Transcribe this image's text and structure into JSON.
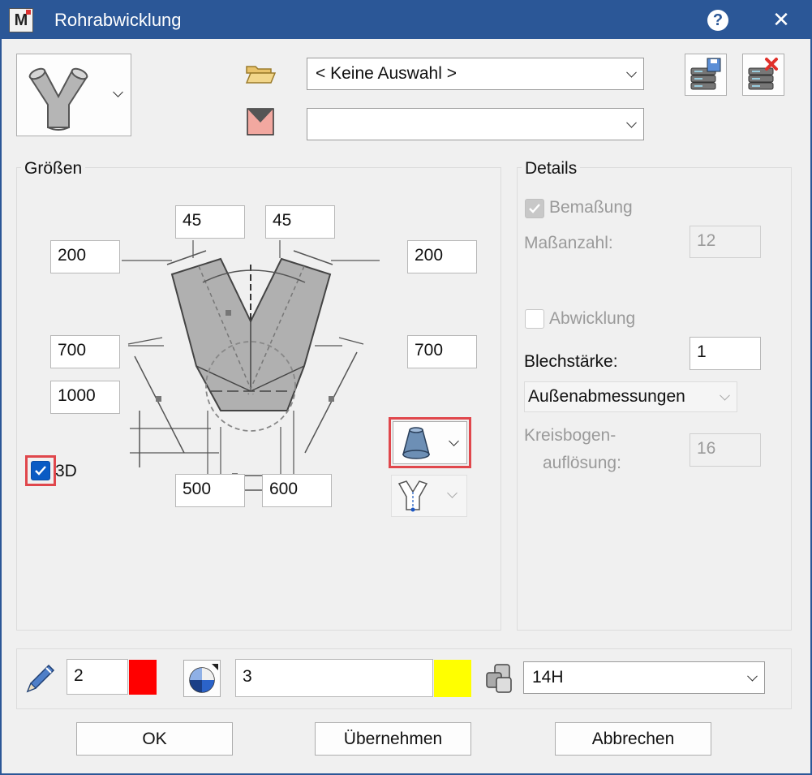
{
  "window": {
    "title": "Rohrabwicklung",
    "app_icon_letter": "M"
  },
  "top": {
    "file_combo": "< Keine Auswahl >",
    "layer_combo": ""
  },
  "sizes": {
    "group_label": "Größen",
    "angle_left": "45",
    "angle_right": "45",
    "length_left": "200",
    "length_right": "200",
    "height_left": "700",
    "height_right": "700",
    "total_height": "1000",
    "width_bottom_left": "500",
    "width_bottom_right": "600",
    "check_3d_label": "3D",
    "check_3d": true
  },
  "details": {
    "group_label": "Details",
    "bemassung_label": "Bemaßung",
    "bemassung_checked": true,
    "masszahl_label": "Maßanzahl:",
    "masszahl_value": "12",
    "abwicklung_label": "Abwicklung",
    "abwicklung_checked": false,
    "blechstaerke_label": "Blechstärke:",
    "blechstaerke_value": "1",
    "dimension_combo": "Außenabmessungen",
    "kreisbogen_label_1": "Kreisbogen-",
    "kreisbogen_label_2": "auflösung:",
    "kreisbogen_value": "16"
  },
  "bottom": {
    "pen_value": "2",
    "pen_color": "#ff0000",
    "line_value": "3",
    "line_color": "#ffff00",
    "layer_value": "14H"
  },
  "buttons": {
    "ok": "OK",
    "apply": "Übernehmen",
    "cancel": "Abbrechen"
  },
  "icons": {
    "pipe_shape": "y-pipe-icon",
    "open_folder": "folder-open-icon",
    "layer": "layer-icon",
    "save_db": "database-save-icon",
    "delete_db": "database-delete-icon",
    "cone": "cone-icon",
    "branch": "y-branch-icon",
    "pen": "pen-icon",
    "line_style": "pie-chart-icon",
    "layers": "layers-icon",
    "help": "help-icon",
    "close": "close-icon"
  }
}
